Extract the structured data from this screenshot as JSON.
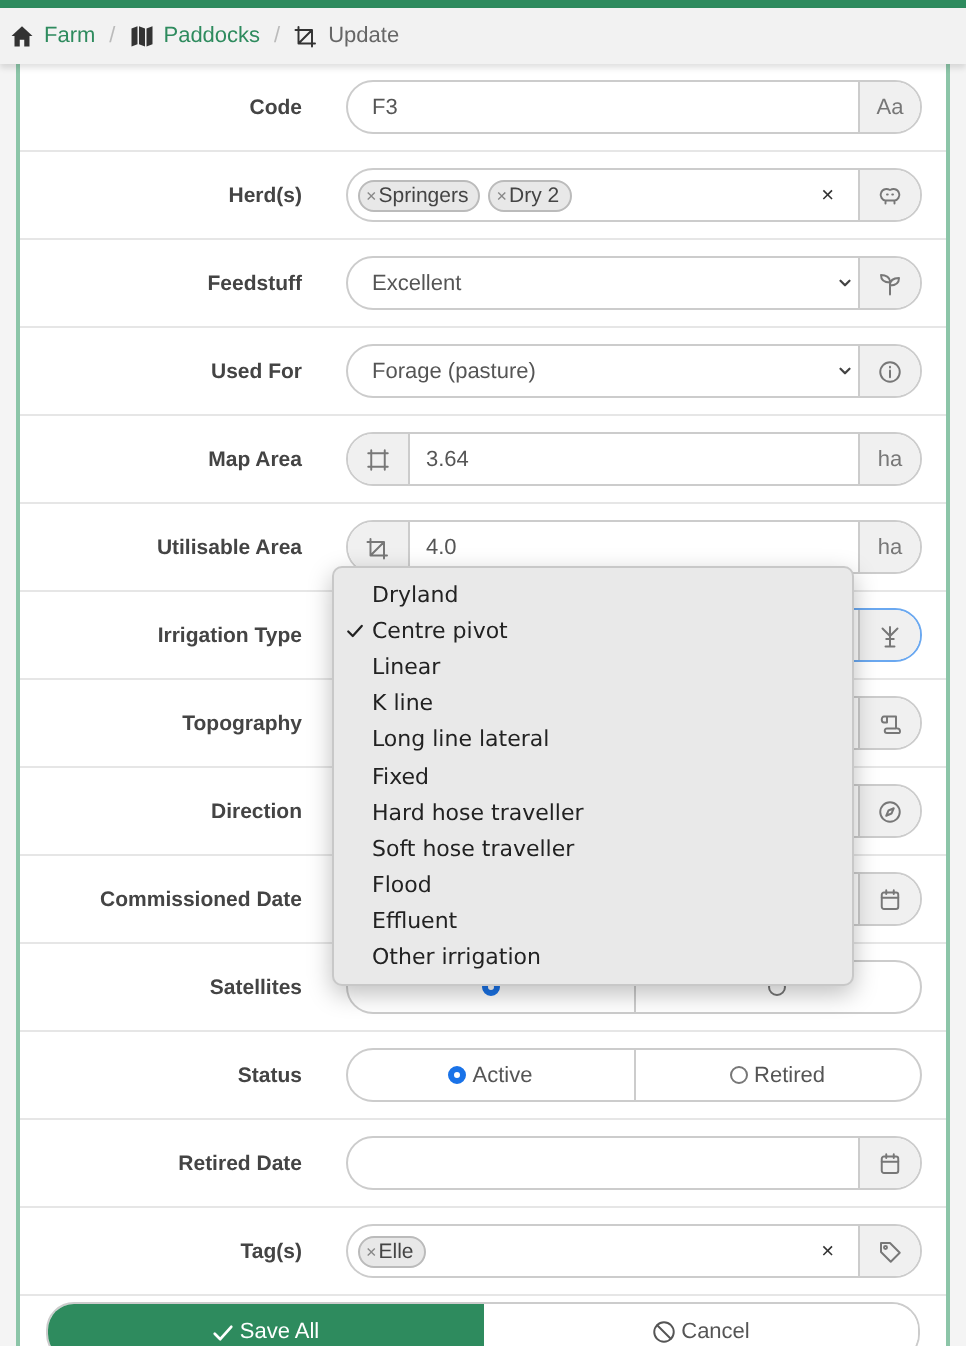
{
  "breadcrumb": {
    "separator": "/",
    "items": [
      {
        "label": "Farm",
        "link": true
      },
      {
        "label": "Paddocks",
        "link": true
      },
      {
        "label": "Update",
        "link": false
      }
    ]
  },
  "fields": [
    {
      "label": "Code",
      "kind": "text",
      "value": "F3",
      "addon": "Aa",
      "focused": false
    },
    {
      "label": "Herd(s)",
      "kind": "tags",
      "chips": [
        {
          "label": "Springers"
        },
        {
          "label": "Dry 2"
        }
      ],
      "chip_remove": "×",
      "clear": "×",
      "focused": false
    },
    {
      "label": "Feedstuff",
      "kind": "select",
      "value": "Excellent",
      "focused": false
    },
    {
      "label": "Used For",
      "kind": "select",
      "value": "Forage (pasture)",
      "focused": false
    },
    {
      "label": "Map Area",
      "kind": "measure",
      "value": "3.64",
      "unit": "ha",
      "focused": false
    },
    {
      "label": "Utilisable Area",
      "kind": "measure",
      "value": "4.0",
      "unit": "ha",
      "focused": false
    },
    {
      "label": "Irrigation Type",
      "kind": "select",
      "focused": true
    },
    {
      "label": "Topography",
      "kind": "select",
      "focused": false
    },
    {
      "label": "Direction",
      "kind": "select",
      "focused": false
    },
    {
      "label": "Commissioned Date",
      "kind": "date",
      "focused": false
    },
    {
      "label": "Satellites",
      "kind": "radio",
      "options": [
        {
          "selected": true
        },
        {
          "selected": false
        }
      ],
      "focused": false
    },
    {
      "label": "Status",
      "kind": "radio",
      "options": [
        {
          "label": "Active",
          "selected": true
        },
        {
          "label": "Retired",
          "selected": false
        }
      ],
      "focused": false
    },
    {
      "label": "Retired Date",
      "kind": "date",
      "focused": false
    },
    {
      "label": "Tag(s)",
      "kind": "tags",
      "chips": [
        {
          "label": "Elle"
        }
      ],
      "chip_remove": "×",
      "clear": "×",
      "focused": false
    }
  ],
  "dropdown": {
    "options": [
      {
        "label": "Dryland",
        "selected": false
      },
      {
        "label": "Centre pivot",
        "selected": true
      },
      {
        "label": "Linear",
        "selected": false
      },
      {
        "label": "K line",
        "selected": false
      },
      {
        "label": "Long line lateral",
        "selected": false
      },
      {
        "label": "Fixed",
        "selected": false
      },
      {
        "label": "Hard hose traveller",
        "selected": false
      },
      {
        "label": "Soft hose traveller",
        "selected": false
      },
      {
        "label": "Flood",
        "selected": false
      },
      {
        "label": "Effluent",
        "selected": false
      },
      {
        "label": "Other irrigation",
        "selected": false
      }
    ]
  },
  "buttons": [
    {
      "label": "Save All",
      "kind": "primary"
    },
    {
      "label": "Cancel",
      "kind": "secondary"
    }
  ]
}
